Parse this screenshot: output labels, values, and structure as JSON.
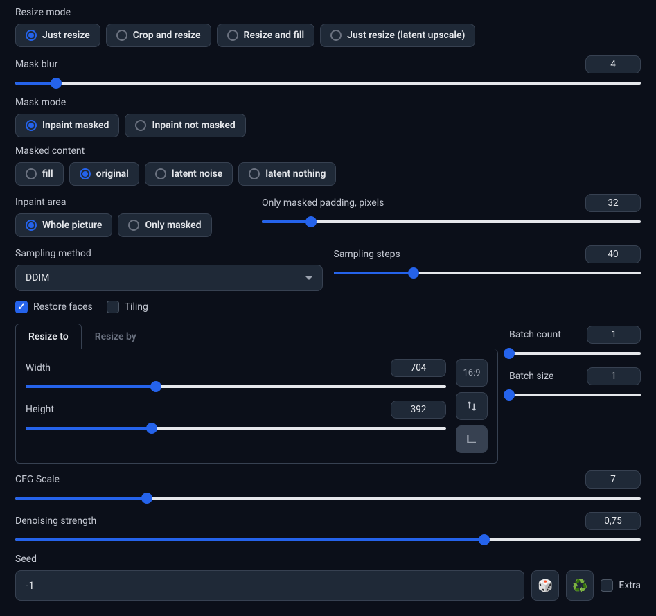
{
  "resize_mode": {
    "label": "Resize mode",
    "options": [
      "Just resize",
      "Crop and resize",
      "Resize and fill",
      "Just resize (latent upscale)"
    ],
    "selected": 0
  },
  "mask_blur": {
    "label": "Mask blur",
    "value": "4",
    "percent": 6.5
  },
  "mask_mode": {
    "label": "Mask mode",
    "options": [
      "Inpaint masked",
      "Inpaint not masked"
    ],
    "selected": 0
  },
  "masked_content": {
    "label": "Masked content",
    "options": [
      "fill",
      "original",
      "latent noise",
      "latent nothing"
    ],
    "selected": 1
  },
  "inpaint_area": {
    "label": "Inpaint area",
    "options": [
      "Whole picture",
      "Only masked"
    ],
    "selected": 0
  },
  "masked_padding": {
    "label": "Only masked padding, pixels",
    "value": "32",
    "percent": 13
  },
  "sampling_method": {
    "label": "Sampling method",
    "value": "DDIM"
  },
  "sampling_steps": {
    "label": "Sampling steps",
    "value": "40",
    "percent": 26
  },
  "restore_faces": {
    "label": "Restore faces",
    "checked": true
  },
  "tiling": {
    "label": "Tiling",
    "checked": false
  },
  "resize_tabs": {
    "to": "Resize to",
    "by": "Resize by",
    "active": 0
  },
  "width": {
    "label": "Width",
    "value": "704",
    "percent": 31
  },
  "height": {
    "label": "Height",
    "value": "392",
    "percent": 30
  },
  "aspect_label": "16:9",
  "batch_count": {
    "label": "Batch count",
    "value": "1",
    "percent": 0
  },
  "batch_size": {
    "label": "Batch size",
    "value": "1",
    "percent": 0
  },
  "cfg_scale": {
    "label": "CFG Scale",
    "value": "7",
    "percent": 21
  },
  "denoising": {
    "label": "Denoising strength",
    "value": "0,75",
    "percent": 75
  },
  "seed": {
    "label": "Seed",
    "value": "-1"
  },
  "extra": {
    "label": "Extra",
    "checked": false
  }
}
